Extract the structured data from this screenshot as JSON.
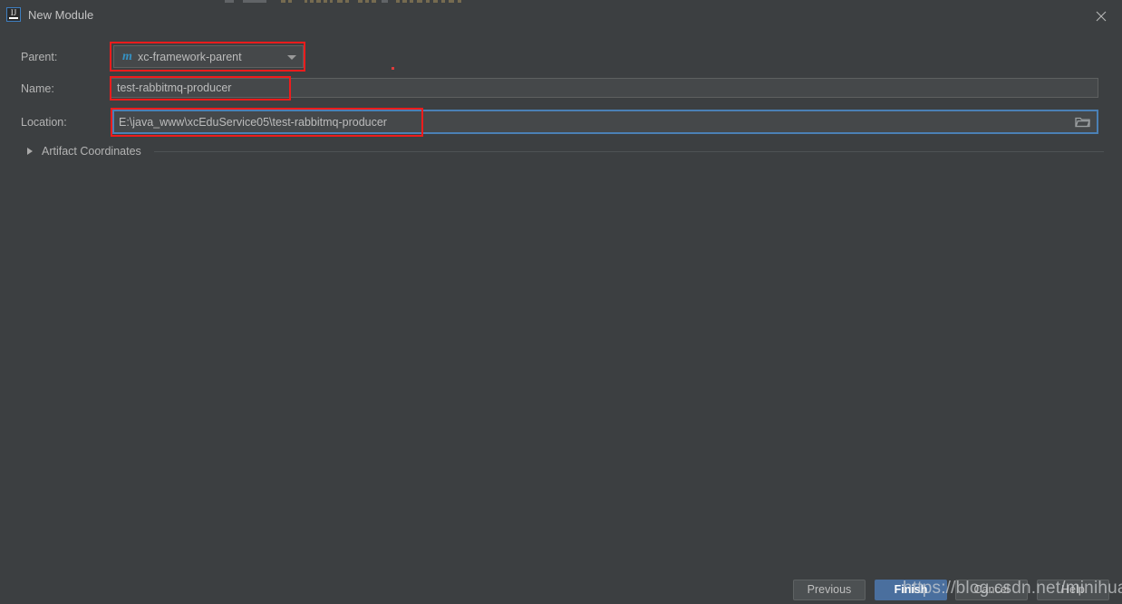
{
  "window": {
    "title": "New Module",
    "app_icon": "intellij-idea-icon",
    "icon_glyph": "IJ",
    "close_icon": "close-icon"
  },
  "form": {
    "parent": {
      "label": "Parent:",
      "icon": "maven-module-icon",
      "icon_glyph": "m",
      "value": "xc-framework-parent",
      "dropdown_icon": "chevron-down-icon"
    },
    "name": {
      "label": "Name:",
      "value": "test-rabbitmq-producer",
      "placeholder": ""
    },
    "location": {
      "label": "Location:",
      "value": "E:\\java_www\\xcEduService05\\test-rabbitmq-producer",
      "placeholder": "",
      "browse_icon": "folder-icon"
    },
    "artifact_coordinates": {
      "label": "Artifact Coordinates",
      "expanded": false,
      "disclosure_icon": "chevron-right-icon"
    }
  },
  "buttons": {
    "previous": "Previous",
    "finish": "Finish",
    "cancel": "Cancel",
    "help": "Help"
  },
  "overlay": {
    "watermark": "https://blog.csdn.net/minihuabei"
  },
  "colors": {
    "background": "#3c3f41",
    "field_background": "#45484a",
    "accent_focus": "#4b80b5",
    "primary_button": "#4a6f9e",
    "annotation": "#ee1c1c",
    "maven_icon": "#3592c4",
    "text": "#bbbbbb"
  }
}
